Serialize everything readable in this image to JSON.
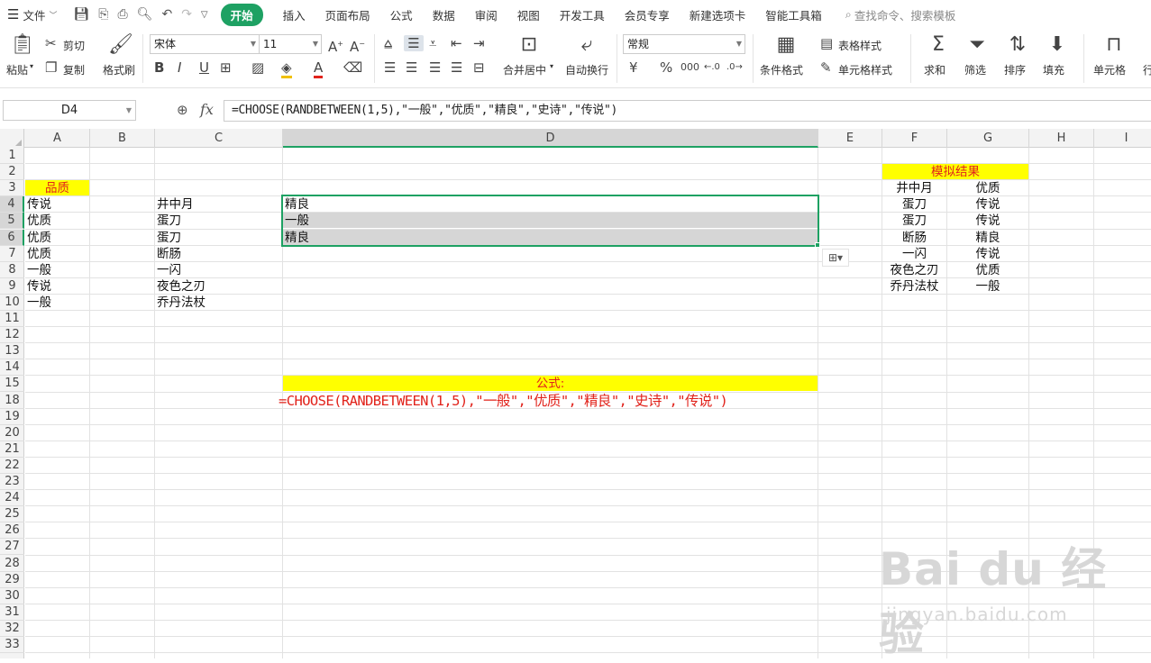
{
  "menubar": {
    "file_label": "文件",
    "tabs": [
      "开始",
      "插入",
      "页面布局",
      "公式",
      "数据",
      "审阅",
      "视图",
      "开发工具",
      "会员专享",
      "新建选项卡",
      "智能工具箱"
    ],
    "active_tab": "开始",
    "search_placeholder": "查找命令、搜索模板"
  },
  "ribbon": {
    "paste": "粘贴",
    "cut": "剪切",
    "copy": "复制",
    "format_painter": "格式刷",
    "font_name": "宋体",
    "font_size": "11",
    "merge_center": "合并居中",
    "wrap_text": "自动换行",
    "number_format": "常规",
    "table_style": "表格样式",
    "cell_style": "单元格样式",
    "conditional_format": "条件格式",
    "sum": "求和",
    "filter": "筛选",
    "sort": "排序",
    "fill": "填充",
    "cell": "单元格",
    "row_col": "行"
  },
  "formula_bar": {
    "name_box": "D4",
    "fx": "fx",
    "formula": "=CHOOSE(RANDBETWEEN(1,5),\"一般\",\"优质\",\"精良\",\"史诗\",\"传说\")"
  },
  "columns": [
    "A",
    "B",
    "C",
    "D",
    "E",
    "F",
    "G",
    "H",
    "I"
  ],
  "selected_column": "D",
  "rows": [
    "1",
    "2",
    "3",
    "4",
    "5",
    "6",
    "7",
    "8",
    "9",
    "10",
    "11",
    "12",
    "13",
    "14",
    "15",
    "18",
    "19",
    "20",
    "21",
    "22",
    "23",
    "24",
    "25",
    "26",
    "27",
    "28",
    "29",
    "30",
    "31",
    "32",
    "33"
  ],
  "sheet": {
    "a3_header": "品质",
    "quality": [
      "传说",
      "优质",
      "优质",
      "优质",
      "一般",
      "传说",
      "一般"
    ],
    "names": [
      "井中月",
      "蛋刀",
      "蛋刀",
      "断肠",
      "一闪",
      "夜色之刃",
      "乔丹法杖"
    ],
    "d_results": [
      "精良",
      "一般",
      "精良"
    ],
    "formula_label": "公式:",
    "formula_text": "=CHOOSE(RANDBETWEEN(1,5),\"一般\",\"优质\",\"精良\",\"史诗\",\"传说\")",
    "sim_header": "模拟结果",
    "sim_names": [
      "井中月",
      "蛋刀",
      "蛋刀",
      "断肠",
      "一闪",
      "夜色之刃",
      "乔丹法杖"
    ],
    "sim_results": [
      "优质",
      "传说",
      "传说",
      "精良",
      "传说",
      "优质",
      "一般"
    ]
  },
  "watermark": {
    "logo": "Bai du 经验",
    "url": "jingyan.baidu.com"
  },
  "colors": {
    "accent": "#1ea163",
    "highlight": "#ffff00",
    "red_text": "#e1231b"
  }
}
